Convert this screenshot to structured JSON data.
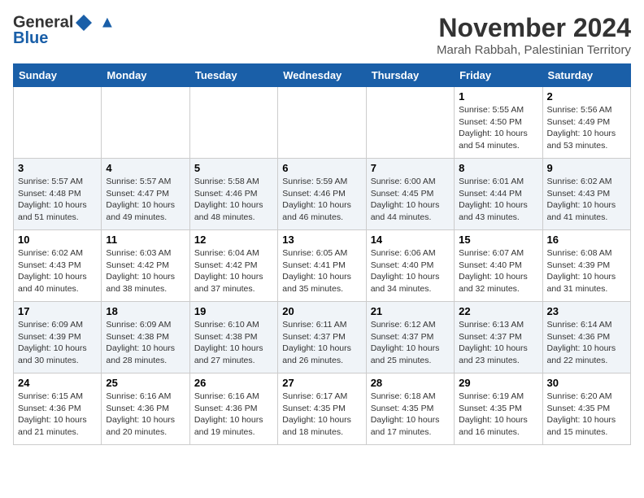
{
  "logo": {
    "general": "General",
    "blue": "Blue"
  },
  "title": "November 2024",
  "subtitle": "Marah Rabbah, Palestinian Territory",
  "days_header": [
    "Sunday",
    "Monday",
    "Tuesday",
    "Wednesday",
    "Thursday",
    "Friday",
    "Saturday"
  ],
  "weeks": [
    [
      {
        "day": "",
        "info": ""
      },
      {
        "day": "",
        "info": ""
      },
      {
        "day": "",
        "info": ""
      },
      {
        "day": "",
        "info": ""
      },
      {
        "day": "",
        "info": ""
      },
      {
        "day": "1",
        "sunrise": "Sunrise: 5:55 AM",
        "sunset": "Sunset: 4:50 PM",
        "daylight": "Daylight: 10 hours and 54 minutes."
      },
      {
        "day": "2",
        "sunrise": "Sunrise: 5:56 AM",
        "sunset": "Sunset: 4:49 PM",
        "daylight": "Daylight: 10 hours and 53 minutes."
      }
    ],
    [
      {
        "day": "3",
        "sunrise": "Sunrise: 5:57 AM",
        "sunset": "Sunset: 4:48 PM",
        "daylight": "Daylight: 10 hours and 51 minutes."
      },
      {
        "day": "4",
        "sunrise": "Sunrise: 5:57 AM",
        "sunset": "Sunset: 4:47 PM",
        "daylight": "Daylight: 10 hours and 49 minutes."
      },
      {
        "day": "5",
        "sunrise": "Sunrise: 5:58 AM",
        "sunset": "Sunset: 4:46 PM",
        "daylight": "Daylight: 10 hours and 48 minutes."
      },
      {
        "day": "6",
        "sunrise": "Sunrise: 5:59 AM",
        "sunset": "Sunset: 4:46 PM",
        "daylight": "Daylight: 10 hours and 46 minutes."
      },
      {
        "day": "7",
        "sunrise": "Sunrise: 6:00 AM",
        "sunset": "Sunset: 4:45 PM",
        "daylight": "Daylight: 10 hours and 44 minutes."
      },
      {
        "day": "8",
        "sunrise": "Sunrise: 6:01 AM",
        "sunset": "Sunset: 4:44 PM",
        "daylight": "Daylight: 10 hours and 43 minutes."
      },
      {
        "day": "9",
        "sunrise": "Sunrise: 6:02 AM",
        "sunset": "Sunset: 4:43 PM",
        "daylight": "Daylight: 10 hours and 41 minutes."
      }
    ],
    [
      {
        "day": "10",
        "sunrise": "Sunrise: 6:02 AM",
        "sunset": "Sunset: 4:43 PM",
        "daylight": "Daylight: 10 hours and 40 minutes."
      },
      {
        "day": "11",
        "sunrise": "Sunrise: 6:03 AM",
        "sunset": "Sunset: 4:42 PM",
        "daylight": "Daylight: 10 hours and 38 minutes."
      },
      {
        "day": "12",
        "sunrise": "Sunrise: 6:04 AM",
        "sunset": "Sunset: 4:42 PM",
        "daylight": "Daylight: 10 hours and 37 minutes."
      },
      {
        "day": "13",
        "sunrise": "Sunrise: 6:05 AM",
        "sunset": "Sunset: 4:41 PM",
        "daylight": "Daylight: 10 hours and 35 minutes."
      },
      {
        "day": "14",
        "sunrise": "Sunrise: 6:06 AM",
        "sunset": "Sunset: 4:40 PM",
        "daylight": "Daylight: 10 hours and 34 minutes."
      },
      {
        "day": "15",
        "sunrise": "Sunrise: 6:07 AM",
        "sunset": "Sunset: 4:40 PM",
        "daylight": "Daylight: 10 hours and 32 minutes."
      },
      {
        "day": "16",
        "sunrise": "Sunrise: 6:08 AM",
        "sunset": "Sunset: 4:39 PM",
        "daylight": "Daylight: 10 hours and 31 minutes."
      }
    ],
    [
      {
        "day": "17",
        "sunrise": "Sunrise: 6:09 AM",
        "sunset": "Sunset: 4:39 PM",
        "daylight": "Daylight: 10 hours and 30 minutes."
      },
      {
        "day": "18",
        "sunrise": "Sunrise: 6:09 AM",
        "sunset": "Sunset: 4:38 PM",
        "daylight": "Daylight: 10 hours and 28 minutes."
      },
      {
        "day": "19",
        "sunrise": "Sunrise: 6:10 AM",
        "sunset": "Sunset: 4:38 PM",
        "daylight": "Daylight: 10 hours and 27 minutes."
      },
      {
        "day": "20",
        "sunrise": "Sunrise: 6:11 AM",
        "sunset": "Sunset: 4:37 PM",
        "daylight": "Daylight: 10 hours and 26 minutes."
      },
      {
        "day": "21",
        "sunrise": "Sunrise: 6:12 AM",
        "sunset": "Sunset: 4:37 PM",
        "daylight": "Daylight: 10 hours and 25 minutes."
      },
      {
        "day": "22",
        "sunrise": "Sunrise: 6:13 AM",
        "sunset": "Sunset: 4:37 PM",
        "daylight": "Daylight: 10 hours and 23 minutes."
      },
      {
        "day": "23",
        "sunrise": "Sunrise: 6:14 AM",
        "sunset": "Sunset: 4:36 PM",
        "daylight": "Daylight: 10 hours and 22 minutes."
      }
    ],
    [
      {
        "day": "24",
        "sunrise": "Sunrise: 6:15 AM",
        "sunset": "Sunset: 4:36 PM",
        "daylight": "Daylight: 10 hours and 21 minutes."
      },
      {
        "day": "25",
        "sunrise": "Sunrise: 6:16 AM",
        "sunset": "Sunset: 4:36 PM",
        "daylight": "Daylight: 10 hours and 20 minutes."
      },
      {
        "day": "26",
        "sunrise": "Sunrise: 6:16 AM",
        "sunset": "Sunset: 4:36 PM",
        "daylight": "Daylight: 10 hours and 19 minutes."
      },
      {
        "day": "27",
        "sunrise": "Sunrise: 6:17 AM",
        "sunset": "Sunset: 4:35 PM",
        "daylight": "Daylight: 10 hours and 18 minutes."
      },
      {
        "day": "28",
        "sunrise": "Sunrise: 6:18 AM",
        "sunset": "Sunset: 4:35 PM",
        "daylight": "Daylight: 10 hours and 17 minutes."
      },
      {
        "day": "29",
        "sunrise": "Sunrise: 6:19 AM",
        "sunset": "Sunset: 4:35 PM",
        "daylight": "Daylight: 10 hours and 16 minutes."
      },
      {
        "day": "30",
        "sunrise": "Sunrise: 6:20 AM",
        "sunset": "Sunset: 4:35 PM",
        "daylight": "Daylight: 10 hours and 15 minutes."
      }
    ]
  ]
}
